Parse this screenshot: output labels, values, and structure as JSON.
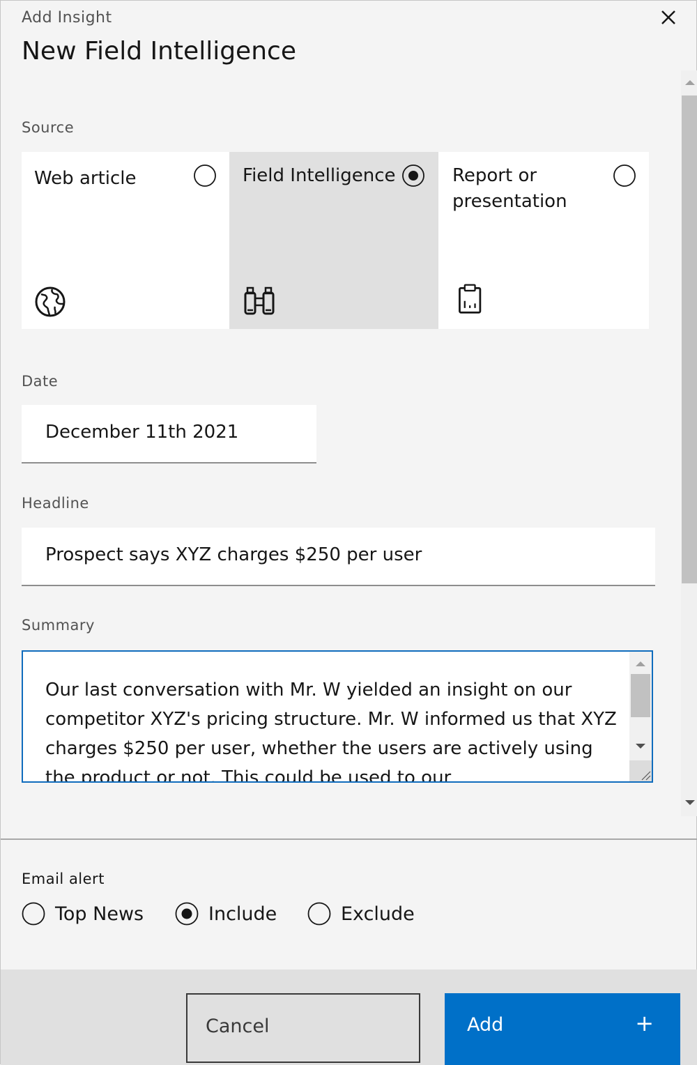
{
  "header": {
    "eyebrow": "Add Insight",
    "title": "New Field Intelligence",
    "close_icon": "close-icon"
  },
  "source": {
    "label": "Source",
    "selected": "Field Intelligence",
    "options": [
      {
        "label": "Web article",
        "icon": "globe-icon",
        "selected": false
      },
      {
        "label": "Field Intelligence",
        "icon": "binoculars-icon",
        "selected": true
      },
      {
        "label": "Report or presentation",
        "icon": "clipboard-report-icon",
        "selected": false
      }
    ]
  },
  "date": {
    "label": "Date",
    "value": "December 11th 2021"
  },
  "headline": {
    "label": "Headline",
    "value": "Prospect says XYZ charges $250 per user"
  },
  "summary": {
    "label": "Summary",
    "value": "Our last conversation with Mr. W yielded an insight on our competitor XYZ's pricing structure. Mr. W informed us that XYZ charges $250 per user, whether the users are actively using the product or not. This could be used to our"
  },
  "email_alert": {
    "label": "Email alert",
    "selected": "Include",
    "options": [
      {
        "label": "Top News",
        "selected": false
      },
      {
        "label": "Include",
        "selected": true
      },
      {
        "label": "Exclude",
        "selected": false
      }
    ]
  },
  "footer": {
    "cancel_label": "Cancel",
    "add_label": "Add",
    "add_icon": "+"
  },
  "colors": {
    "primary": "#0070c8",
    "focus_border": "#0f6cbd",
    "selected_tile": "#e0e0e0",
    "background": "#f4f4f4"
  }
}
